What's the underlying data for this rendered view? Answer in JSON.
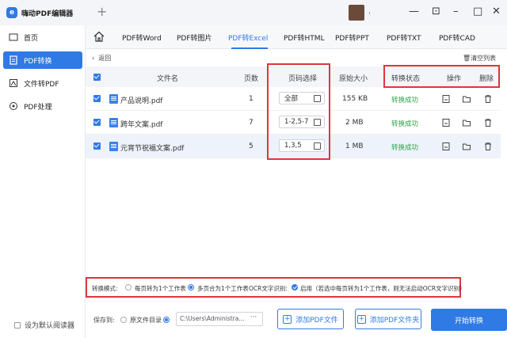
{
  "app": {
    "title": "嗨动PDF编辑器",
    "logo": "e",
    "new_tab": "+",
    "username": "."
  },
  "window": {
    "icons": [
      "minimize-icon",
      "fullscreen-icon",
      "minimize-window-icon",
      "restore-icon",
      "close-icon"
    ],
    "min": "—",
    "max": "⊡",
    "min2": "–",
    "restore": "□",
    "close": "✕"
  },
  "sidebar": {
    "items": [
      {
        "label": "首页",
        "icon": "home-icon"
      },
      {
        "label": "PDF转换",
        "icon": "convert-icon",
        "active": true
      },
      {
        "label": "文件转PDF",
        "icon": "file-to-pdf-icon"
      },
      {
        "label": "PDF处理",
        "icon": "pdf-process-icon"
      }
    ],
    "default_reader": "设为默认阅读器"
  },
  "tabs": [
    "PDF转Word",
    "PDF转图片",
    "PDF转Excel",
    "PDF转HTML",
    "PDF转PPT",
    "PDF转TXT",
    "PDF转CAD"
  ],
  "active_tab": "PDF转Excel",
  "toolbar": {
    "back": "返回",
    "clear": "清空列表"
  },
  "table": {
    "headers": {
      "filename": "文件名",
      "pages": "页数",
      "page_select": "页码选择",
      "orig_size": "原始大小",
      "status": "转换状态",
      "ops": "操作",
      "delete": "删除"
    },
    "rows": [
      {
        "name": "产品说明.pdf",
        "pages": "1",
        "page_select": "全部",
        "size": "155 KB",
        "status": "转换成功"
      },
      {
        "name": "跨年文案.pdf",
        "pages": "7",
        "page_select": "1-2,5-7",
        "size": "2 MB",
        "status": "转换成功"
      },
      {
        "name": "元宵节祝福文案.pdf",
        "pages": "5",
        "page_select": "1,3,5",
        "size": "1 MB",
        "status": "转换成功"
      }
    ]
  },
  "mode": {
    "label": "转换模式:",
    "option1": "每页转为1个工作表",
    "option2": "多页合为1个工作表",
    "ocr_label": "OCR文字识别:",
    "ocr_on": "启用（若选中每页转为1个工作表，则无法启动OCR文字识别）"
  },
  "bottom": {
    "save_to": "保存到:",
    "source_dir": "原文件目录",
    "path": "C:\\Users\\Administra...",
    "path_more": "···",
    "add_file": "添加PDF文件",
    "add_folder": "添加PDF文件夹",
    "start": "开始转换"
  },
  "colors": {
    "accent": "#2f7ae5",
    "success": "#2aa64a",
    "highlight": "#e0353b"
  }
}
